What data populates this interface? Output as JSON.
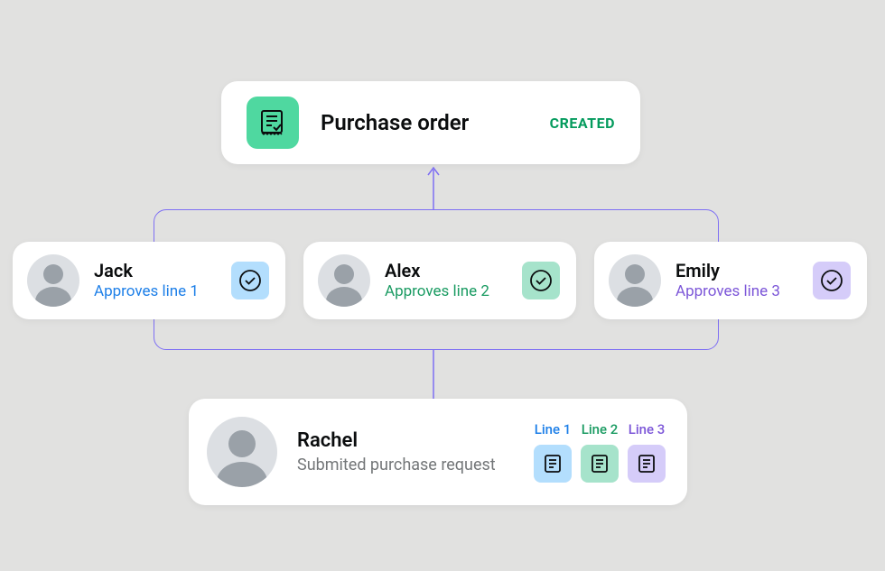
{
  "purchase_order": {
    "title": "Purchase order",
    "status": "CREATED"
  },
  "approvers": [
    {
      "name": "Jack",
      "action": "Approves line 1",
      "color": "blue"
    },
    {
      "name": "Alex",
      "action": "Approves line 2",
      "color": "green"
    },
    {
      "name": "Emily",
      "action": "Approves line 3",
      "color": "purple"
    }
  ],
  "requester": {
    "name": "Rachel",
    "action": "Submited purchase request",
    "lines": [
      {
        "label": "Line 1",
        "color": "blue"
      },
      {
        "label": "Line 2",
        "color": "green"
      },
      {
        "label": "Line 3",
        "color": "purple"
      }
    ]
  },
  "colors": {
    "blue": "#1d7fe8",
    "green": "#1a9b62",
    "purple": "#7c56d8",
    "accent_green": "#4fd8a0",
    "connector": "#7e6ff4"
  }
}
